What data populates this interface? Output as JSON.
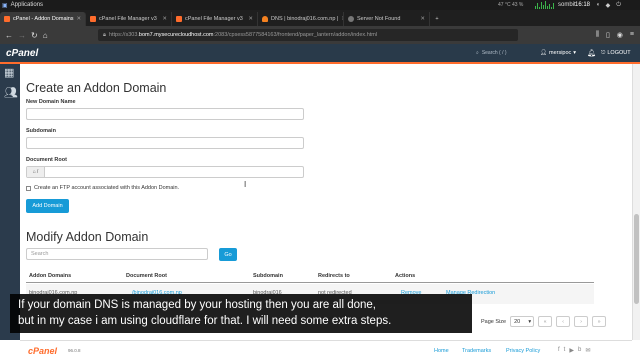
{
  "os": {
    "apps_label": "Applications",
    "stats": "47 °C  43 %",
    "user": "sombit",
    "time": "16:18"
  },
  "tabs": [
    {
      "label": "cPanel - Addon Domains",
      "color": "#ff6c2c",
      "active": true
    },
    {
      "label": "cPanel File Manager v3",
      "color": "#ff6c2c",
      "active": false
    },
    {
      "label": "cPanel File Manager v3",
      "color": "#ff6c2c",
      "active": false
    },
    {
      "label": "DNS | binodraj016.com.np |",
      "color": "#f48120",
      "active": false
    },
    {
      "label": "Server Not Found",
      "color": "#777777",
      "active": false
    }
  ],
  "address": {
    "url_prefix": "https://s303.",
    "url_host": "bom7.mysecurecloudhost.com",
    "url_rest": ":2083/cpsess5877584163/frontend/paper_lantern/addon/index.html"
  },
  "cpanel": {
    "logo": "cPanel",
    "search_placeholder": "Search ( / )",
    "user": "mersipoc",
    "logout": "LOGOUT"
  },
  "create": {
    "title": "Create an Addon Domain",
    "new_domain_label": "New Domain Name",
    "subdomain_label": "Subdomain",
    "docroot_label": "Document Root",
    "docroot_prefix": "/",
    "ftp_checkbox_label": "Create an FTP account associated with this Addon Domain.",
    "add_button": "Add Domain"
  },
  "modify": {
    "title": "Modify Addon Domain",
    "search_placeholder": "Search",
    "go_button": "Go",
    "columns": [
      "Addon Domains",
      "Document Root",
      "Subdomain",
      "Redirects to",
      "Actions"
    ],
    "row": {
      "domain": "binodraj016.com.np",
      "docroot": "/binodraj016.com.np",
      "subdomain": "binodraj016",
      "redirects": "not redirected",
      "action_remove": "Remove",
      "action_manage": "Manage Redirection"
    },
    "page_size_label": "Page Size",
    "page_size_value": "20"
  },
  "subtitle": {
    "line1": "If your domain DNS is managed by your hosting then you are all done,",
    "line2": "but in my case i am using cloudflare for that. I will need some extra steps."
  },
  "footer": {
    "logo": "cPanel",
    "version": "96.0.8",
    "links": [
      "Home",
      "Trademarks",
      "Privacy Policy"
    ]
  }
}
